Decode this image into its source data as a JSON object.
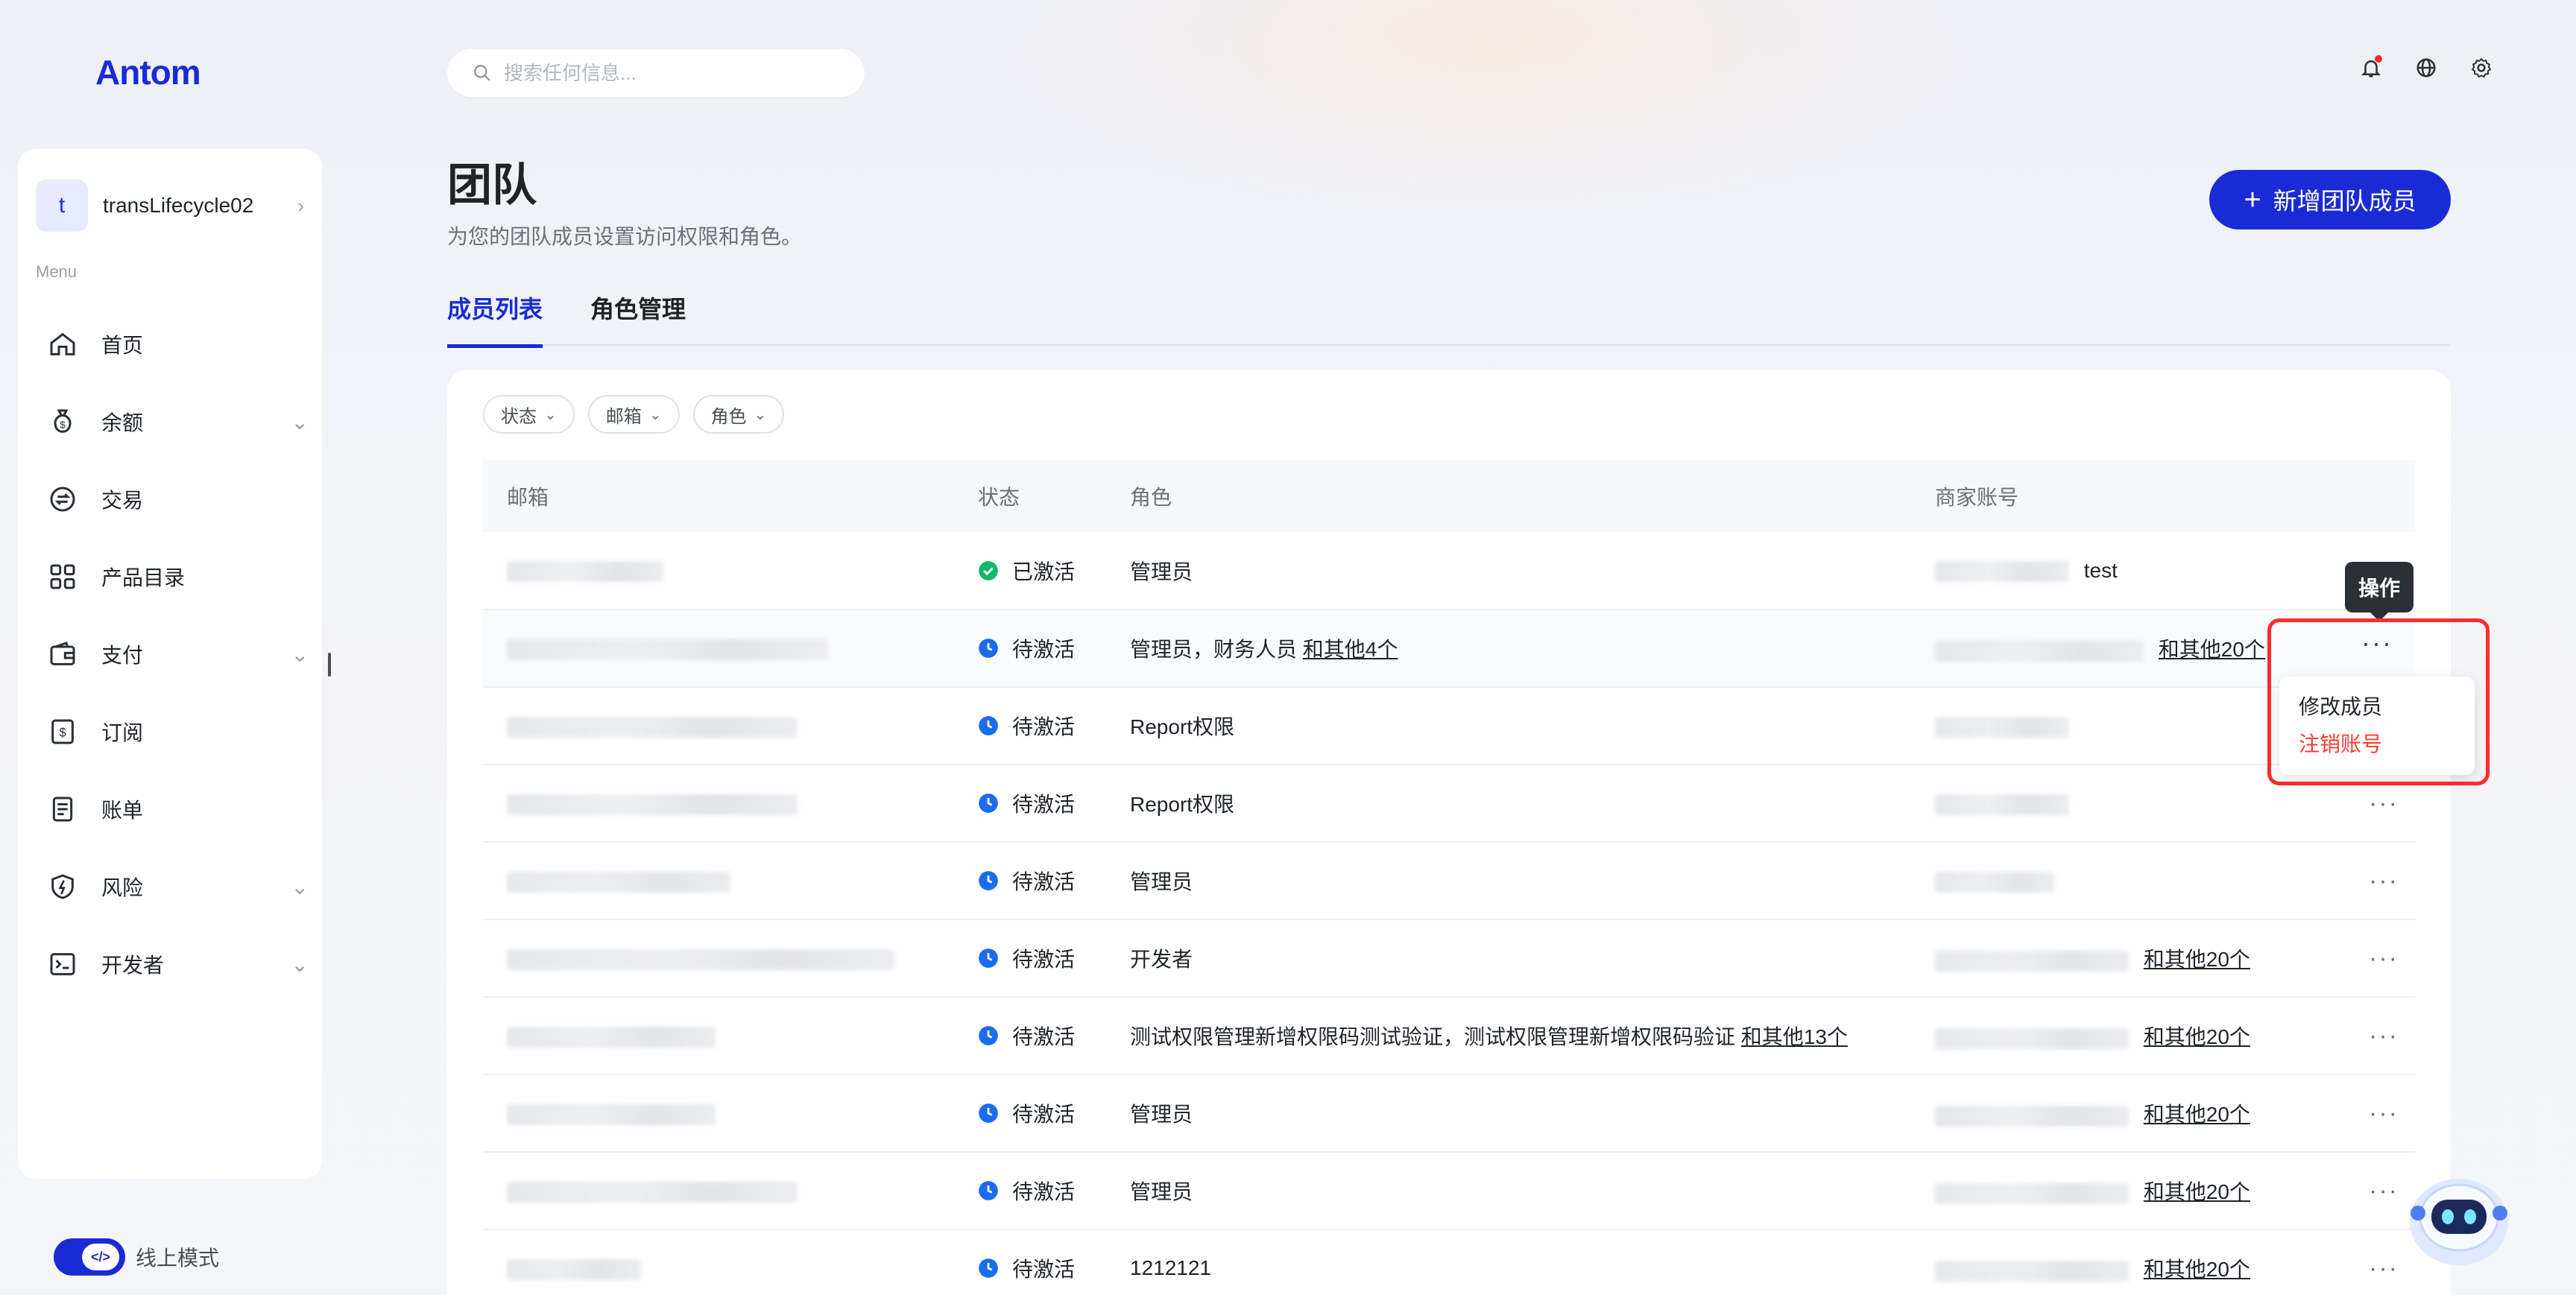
{
  "brand": {
    "logo": "Antom"
  },
  "search": {
    "placeholder": "搜索任何信息..."
  },
  "topbar": {
    "icons": [
      "bell-icon",
      "globe-icon",
      "gear-icon"
    ]
  },
  "sidebar": {
    "account": {
      "initial": "t",
      "name": "transLifecycle02"
    },
    "menu_label": "Menu",
    "items": [
      {
        "label": "首页",
        "icon": "home-icon",
        "expandable": false
      },
      {
        "label": "余额",
        "icon": "money-bag-icon",
        "expandable": true
      },
      {
        "label": "交易",
        "icon": "exchange-icon",
        "expandable": false
      },
      {
        "label": "产品目录",
        "icon": "grid-icon",
        "expandable": false
      },
      {
        "label": "支付",
        "icon": "wallet-icon",
        "expandable": true
      },
      {
        "label": "订阅",
        "icon": "subscription-icon",
        "expandable": false
      },
      {
        "label": "账单",
        "icon": "bill-icon",
        "expandable": false
      },
      {
        "label": "风险",
        "icon": "shield-icon",
        "expandable": true
      },
      {
        "label": "开发者",
        "icon": "terminal-icon",
        "expandable": true
      }
    ],
    "mode_label": "线上模式"
  },
  "page": {
    "title": "团队",
    "subtitle": "为您的团队成员设置访问权限和角色。",
    "add_button": "新增团队成员",
    "tabs": [
      {
        "label": "成员列表",
        "active": true
      },
      {
        "label": "角色管理",
        "active": false
      }
    ]
  },
  "filters": [
    "状态",
    "邮箱",
    "角色"
  ],
  "table": {
    "headers": [
      "邮箱",
      "状态",
      "角色",
      "商家账号"
    ],
    "rows": [
      {
        "status": "已激活",
        "status_type": "active",
        "role": "管理员",
        "role_more": "",
        "merchant_suffix": "test",
        "merchant_more": ""
      },
      {
        "status": "待激活",
        "status_type": "pending",
        "role": "管理员，财务人员",
        "role_more": "和其他4个",
        "merchant_suffix": "",
        "merchant_more": "和其他20个"
      },
      {
        "status": "待激活",
        "status_type": "pending",
        "role": "Report权限",
        "role_more": "",
        "merchant_suffix": "",
        "merchant_more": ""
      },
      {
        "status": "待激活",
        "status_type": "pending",
        "role": "Report权限",
        "role_more": "",
        "merchant_suffix": "",
        "merchant_more": ""
      },
      {
        "status": "待激活",
        "status_type": "pending",
        "role": "管理员",
        "role_more": "",
        "merchant_suffix": "",
        "merchant_more": ""
      },
      {
        "status": "待激活",
        "status_type": "pending",
        "role": "开发者",
        "role_more": "",
        "merchant_suffix": "",
        "merchant_more": "和其他20个"
      },
      {
        "status": "待激活",
        "status_type": "pending",
        "role": "测试权限管理新增权限码测试验证，测试权限管理新增权限码验证",
        "role_more": "和其他13个",
        "merchant_suffix": "",
        "merchant_more": "和其他20个"
      },
      {
        "status": "待激活",
        "status_type": "pending",
        "role": "管理员",
        "role_more": "",
        "merchant_suffix": "",
        "merchant_more": "和其他20个"
      },
      {
        "status": "待激活",
        "status_type": "pending",
        "role": "管理员",
        "role_more": "",
        "merchant_suffix": "",
        "merchant_more": "和其他20个"
      },
      {
        "status": "待激活",
        "status_type": "pending",
        "role": "1212121",
        "role_more": "",
        "merchant_suffix": "",
        "merchant_more": "和其他20个"
      }
    ]
  },
  "tooltip": "操作",
  "action_menu": {
    "edit": "修改成员",
    "deactivate": "注销账号"
  },
  "colors": {
    "accent": "#1a2bd6",
    "active_green": "#12b76a",
    "pending_blue": "#1a6cf0",
    "danger": "#ff3b30"
  }
}
